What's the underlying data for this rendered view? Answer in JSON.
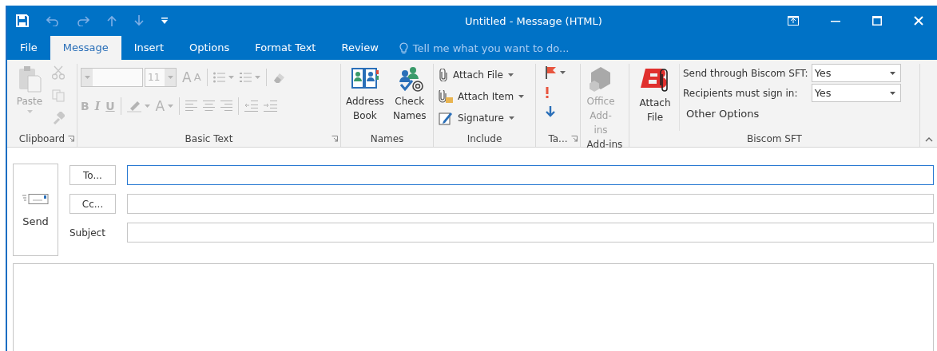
{
  "window": {
    "title": "Untitled - Message (HTML)"
  },
  "tabs": [
    {
      "label": "File",
      "selected": false
    },
    {
      "label": "Message",
      "selected": true
    },
    {
      "label": "Insert",
      "selected": false
    },
    {
      "label": "Options",
      "selected": false
    },
    {
      "label": "Format Text",
      "selected": false
    },
    {
      "label": "Review",
      "selected": false
    }
  ],
  "tell_me": {
    "placeholder": "Tell me what you want to do..."
  },
  "ribbon": {
    "clipboard": {
      "label": "Clipboard",
      "paste": "Paste",
      "disabled": true
    },
    "basic_text": {
      "label": "Basic Text",
      "font_size": "11",
      "disabled": true,
      "row1": [
        {
          "label": "A",
          "kind": "grow"
        },
        {
          "label": "A",
          "kind": "shrink"
        }
      ],
      "row2": [
        {
          "label": "B",
          "kind": "bold"
        },
        {
          "label": "I",
          "kind": "italic"
        },
        {
          "label": "U",
          "kind": "underline"
        },
        {
          "label": "A",
          "kind": "color"
        }
      ]
    },
    "names": {
      "label": "Names",
      "buttons": [
        {
          "label": "Address Book",
          "kind": "book"
        },
        {
          "label": "Check Names",
          "kind": "check"
        }
      ]
    },
    "include": {
      "label": "Include",
      "buttons": [
        {
          "label": "Attach File",
          "kind": "clip"
        },
        {
          "label": "Attach Item",
          "kind": "item"
        },
        {
          "label": "Signature",
          "kind": "sign"
        }
      ]
    },
    "tags": {
      "label": "Ta..."
    },
    "addins": {
      "label": "Add-ins",
      "button": "Office Add-ins",
      "disabled": true
    },
    "biscom": {
      "label": "Biscom SFT",
      "button": "Attach File",
      "options": [
        {
          "label": "Send through Biscom SFT:",
          "value": "Yes"
        },
        {
          "label": "Recipients must sign in:",
          "value": "Yes"
        }
      ],
      "other": "Other Options"
    }
  },
  "compose": {
    "send": "Send",
    "to": "To...",
    "cc": "Cc...",
    "subject": "Subject",
    "to_focused": true
  }
}
